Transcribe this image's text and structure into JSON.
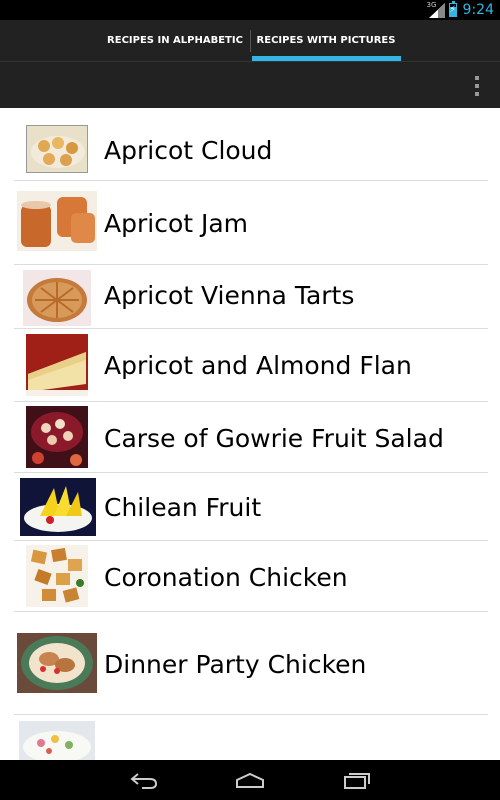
{
  "status_bar": {
    "network_label": "3G",
    "time": "9:24",
    "accent_color": "#33b5e5"
  },
  "tabs": [
    {
      "label": "RECIPES IN ALPHABETIC",
      "selected": false
    },
    {
      "label": "RECIPES WITH PICTURES",
      "selected": true
    }
  ],
  "action_bar": {
    "overflow_icon": "overflow-menu-icon"
  },
  "recipes": [
    {
      "name": "Apricot Cloud",
      "image": "apricot-cloud-thumbnail"
    },
    {
      "name": "Apricot Jam",
      "image": "apricot-jam-thumbnail"
    },
    {
      "name": "Apricot Vienna Tarts",
      "image": "apricot-vienna-tarts-thumbnail"
    },
    {
      "name": "Apricot and Almond Flan",
      "image": "apricot-almond-flan-thumbnail"
    },
    {
      "name": "Carse of Gowrie Fruit Salad",
      "image": "fruit-salad-thumbnail"
    },
    {
      "name": "Chilean Fruit",
      "image": "chilean-fruit-thumbnail"
    },
    {
      "name": "Coronation Chicken",
      "image": "coronation-chicken-thumbnail"
    },
    {
      "name": "Dinner Party Chicken",
      "image": "dinner-party-chicken-thumbnail"
    },
    {
      "name": "",
      "image": "partial-next-recipe-thumbnail"
    }
  ],
  "nav_bar": {
    "back_icon": "back-icon",
    "home_icon": "home-icon",
    "recents_icon": "recent-apps-icon"
  }
}
